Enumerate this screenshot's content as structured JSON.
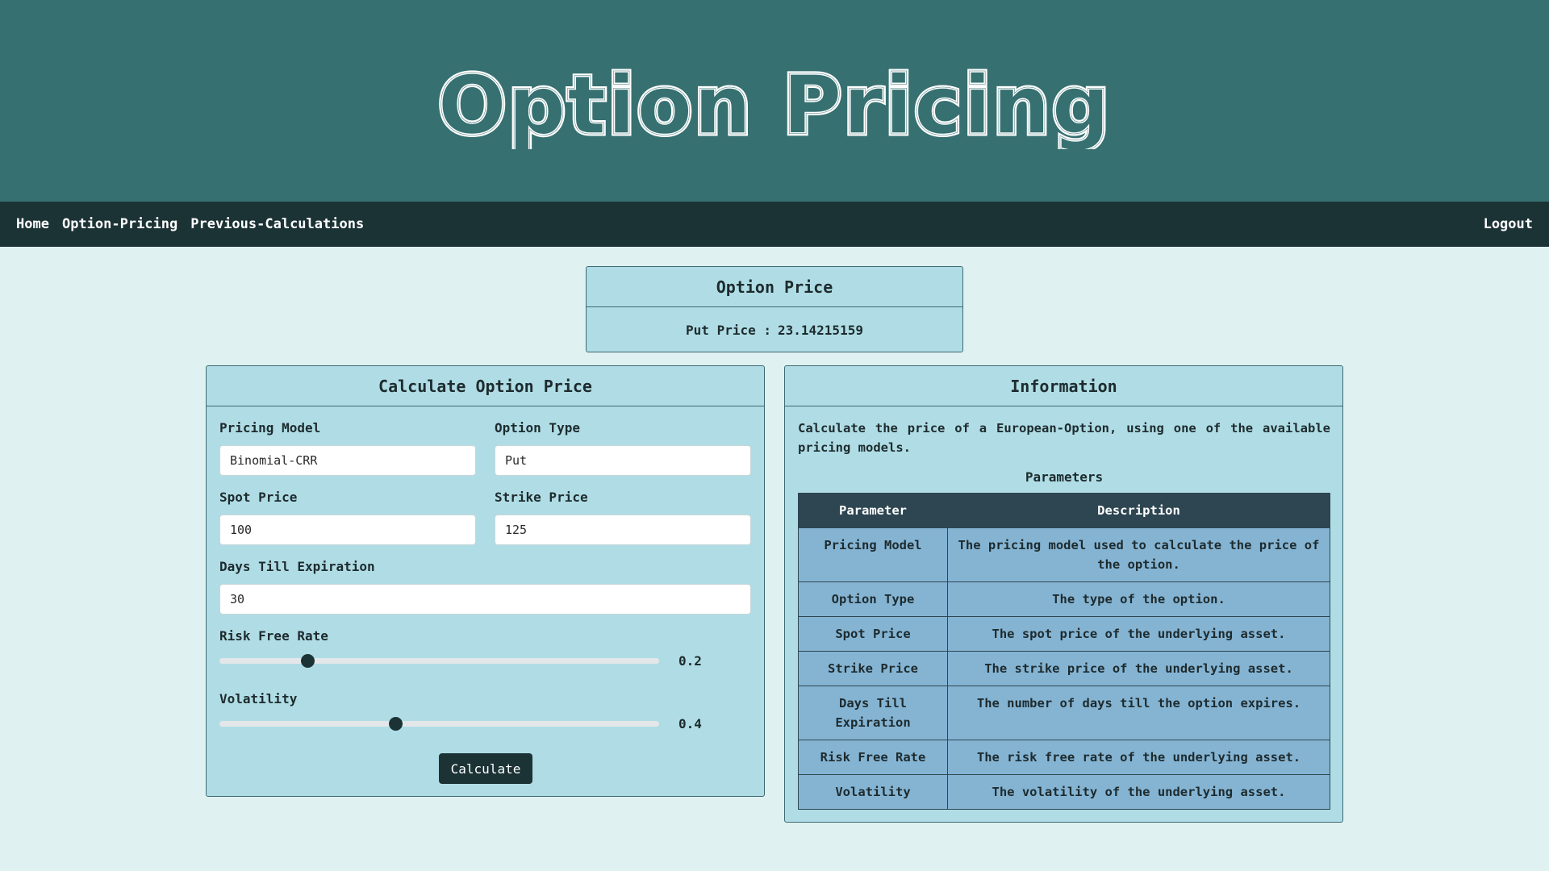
{
  "banner": {
    "title": "Option Pricing"
  },
  "nav": {
    "home": "Home",
    "option_pricing": "Option-Pricing",
    "previous_calculations": "Previous-Calculations",
    "logout": "Logout"
  },
  "result": {
    "title": "Option Price",
    "label": "Put Price :",
    "value": "23.14215159"
  },
  "calculator": {
    "title": "Calculate Option Price",
    "pricing_model_label": "Pricing Model",
    "pricing_model_value": "Binomial-CRR",
    "option_type_label": "Option Type",
    "option_type_value": "Put",
    "spot_price_label": "Spot Price",
    "spot_price_value": "100",
    "strike_price_label": "Strike Price",
    "strike_price_value": "125",
    "days_label": "Days Till Expiration",
    "days_value": "30",
    "risk_free_label": "Risk Free Rate",
    "risk_free_value": "0.2",
    "risk_free_fraction": 0.2,
    "volatility_label": "Volatility",
    "volatility_value": "0.4",
    "volatility_fraction": 0.4,
    "calculate_label": "Calculate"
  },
  "info": {
    "title": "Information",
    "description": "Calculate the price of a European-Option, using one of the available pricing models.",
    "params_caption": "Parameters",
    "col_parameter": "Parameter",
    "col_description": "Description",
    "rows": [
      {
        "parameter": "Pricing Model",
        "description": "The pricing model used to calculate the price of the option."
      },
      {
        "parameter": "Option Type",
        "description": "The type of the option."
      },
      {
        "parameter": "Spot Price",
        "description": "The spot price of the underlying asset."
      },
      {
        "parameter": "Strike Price",
        "description": "The strike price of the underlying asset."
      },
      {
        "parameter": "Days Till Expiration",
        "description": "The number of days till the option expires."
      },
      {
        "parameter": "Risk Free Rate",
        "description": "The risk free rate of the underlying asset."
      },
      {
        "parameter": "Volatility",
        "description": "The volatility of the underlying asset."
      }
    ]
  },
  "colors": {
    "banner": "#377071",
    "nav": "#1c3336",
    "page": "#dff1f0",
    "panel": "#b0dde5",
    "table_header": "#2d4651",
    "table_cell": "#85b4d3"
  }
}
